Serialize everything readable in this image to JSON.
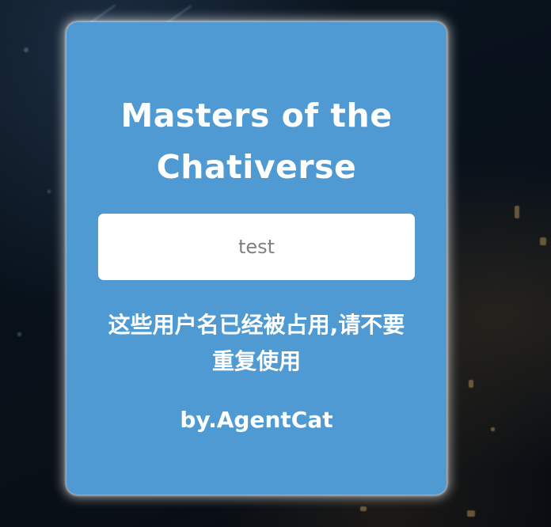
{
  "card": {
    "title": "Masters of the Chativerse",
    "username_input": {
      "value": "test",
      "placeholder": ""
    },
    "warning": "这些用户名已经被占用,请不要重复使用",
    "credit": "by.AgentCat"
  },
  "colors": {
    "card_background": "#4f9ad2",
    "text": "#ffffff",
    "input_background": "#ffffff",
    "input_text": "#808080",
    "page_background": "#0a1118"
  }
}
